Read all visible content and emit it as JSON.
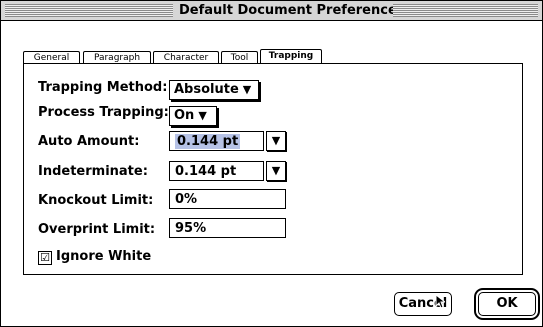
{
  "window": {
    "title": "Default Document Preferences"
  },
  "tabs": [
    {
      "label": "General"
    },
    {
      "label": "Paragraph"
    },
    {
      "label": "Character"
    },
    {
      "label": "Tool"
    },
    {
      "label": "Trapping"
    }
  ],
  "active_tab": "Trapping",
  "form": {
    "trapping_method": {
      "label": "Trapping Method:",
      "value": "Absolute"
    },
    "process_trapping": {
      "label": "Process Trapping:",
      "value": "On"
    },
    "auto_amount": {
      "label": "Auto Amount:",
      "value": "0.144  pt"
    },
    "indeterminate": {
      "label": "Indeterminate:",
      "value": "0.144  pt"
    },
    "knockout_limit": {
      "label": "Knockout Limit:",
      "value": "0%"
    },
    "overprint_limit": {
      "label": "Overprint Limit:",
      "value": "95%"
    },
    "ignore_white": {
      "label": "Ignore White",
      "checked": true,
      "checkmark": "☑"
    }
  },
  "buttons": {
    "cancel": "Cancel",
    "ok": "OK"
  },
  "icons": {
    "popup_arrow": "▼"
  },
  "colors": {
    "selection": "#b6c2e6"
  }
}
